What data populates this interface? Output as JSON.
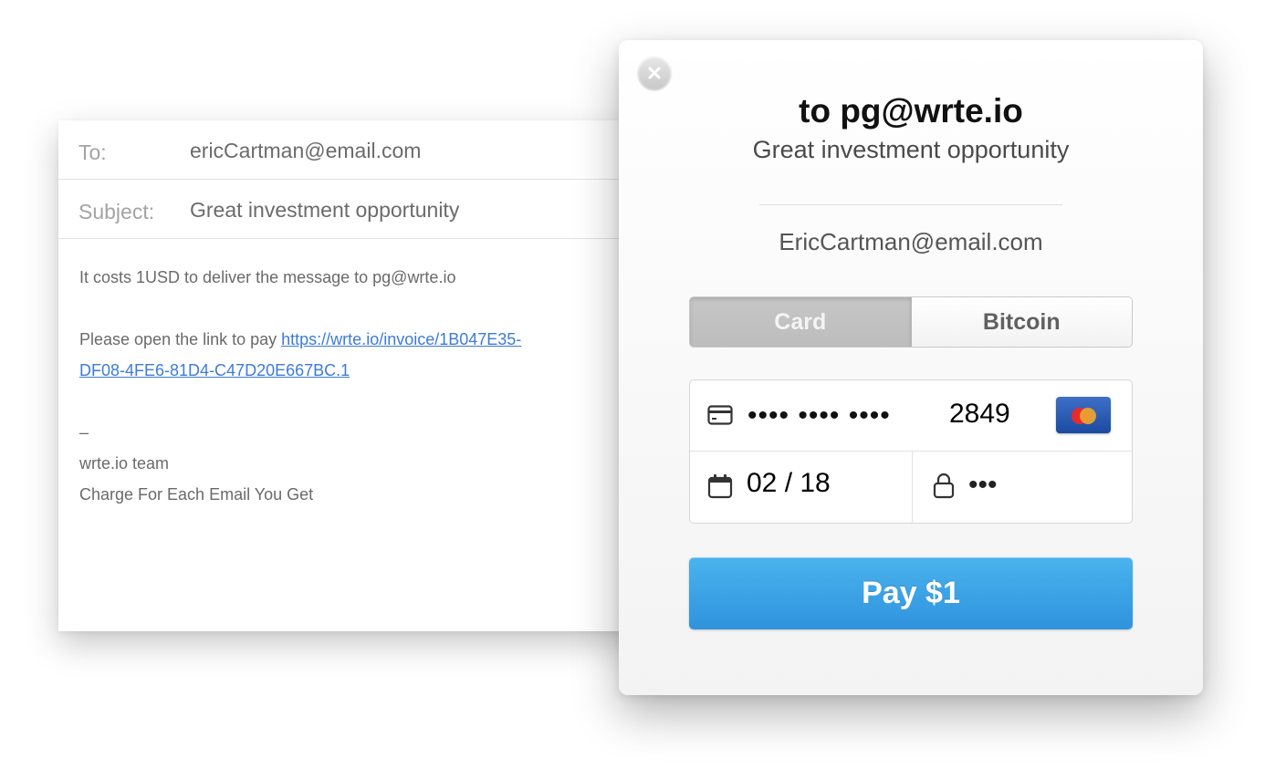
{
  "email": {
    "to_label": "To:",
    "to_value": "ericCartman@email.com",
    "subject_label": "Subject:",
    "subject_value": "Great investment opportunity",
    "body": {
      "line1": "It costs 1USD to deliver the message to pg@wrte.io",
      "pay_prefix": "Please open the link to pay ",
      "invoice_link_part1": "https://wrte.io/invoice/1B047E35-",
      "invoice_link_part2": "DF08-4FE6-81D4-C47D20E667BC.1",
      "separator": "–",
      "team": "wrte.io team",
      "tagline": "Charge For Each Email You Get"
    }
  },
  "modal": {
    "title": "to pg@wrte.io",
    "subtitle": "Great investment opportunity",
    "payer_email": "EricCartman@email.com",
    "tabs": [
      {
        "label": "Card",
        "active": true
      },
      {
        "label": "Bitcoin",
        "active": false
      }
    ],
    "card": {
      "masked_number": "•••• •••• ••••",
      "last4": "2849",
      "brand_icon": "mastercard-icon",
      "expiry": "02 / 18",
      "cvc_masked": "•••"
    },
    "pay_button": "Pay $1",
    "icons": {
      "close": "close-icon",
      "card": "credit-card-icon",
      "calendar": "calendar-icon",
      "lock": "lock-icon"
    },
    "colors": {
      "pay_button": "#3aa3e6",
      "active_tab": "#c3c3c3",
      "link": "#3d7bd8"
    }
  }
}
